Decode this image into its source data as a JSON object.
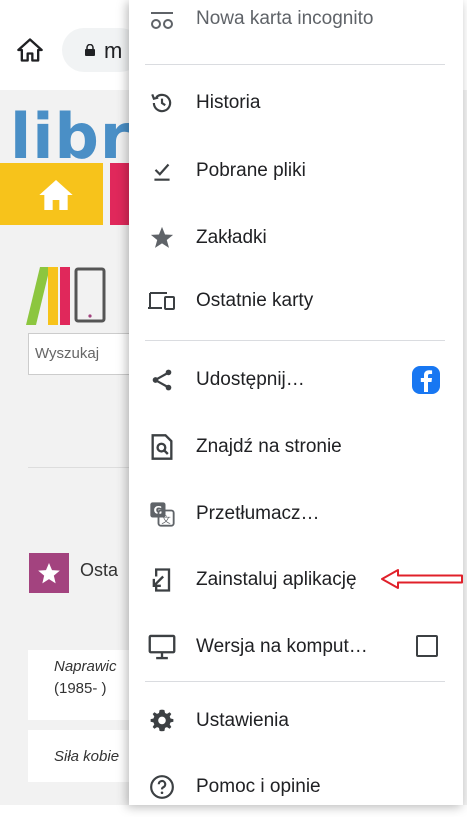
{
  "browser": {
    "url_partial": "m"
  },
  "page": {
    "logo_partial": "libr",
    "search_placeholder": "Wyszukaj",
    "section_label_partial": "Osta",
    "row1_title_partial": "Naprawic",
    "row1_subtitle_partial": "(1985- )",
    "row2_title_partial": "Siła kobie"
  },
  "menu": {
    "incognito_label": "Nowa karta incognito",
    "items": [
      {
        "label": "Historia",
        "icon": "history-icon"
      },
      {
        "label": "Pobrane pliki",
        "icon": "downloads-icon"
      },
      {
        "label": "Zakładki",
        "icon": "bookmark-star-icon"
      },
      {
        "label": "Ostatnie karty",
        "icon": "devices-icon"
      },
      {
        "label": "Udostępnij…",
        "icon": "share-icon"
      },
      {
        "label": "Znajdź na stronie",
        "icon": "find-in-page-icon"
      },
      {
        "label": "Przetłumacz…",
        "icon": "translate-icon"
      },
      {
        "label": "Zainstaluj aplikację",
        "icon": "install-app-icon"
      },
      {
        "label": "Wersja na komput…",
        "icon": "desktop-icon"
      },
      {
        "label": "Ustawienia",
        "icon": "settings-gear-icon"
      },
      {
        "label": "Pomoc i opinie",
        "icon": "help-icon"
      }
    ],
    "desktop_checked": false
  },
  "colors": {
    "logo_blue": "#4a8fc6",
    "banner_yellow": "#f7c31b",
    "banner_red": "#e0285b",
    "accent_purple": "#a3437f",
    "facebook_blue": "#1877f2",
    "annotation_red": "#e0202a"
  }
}
